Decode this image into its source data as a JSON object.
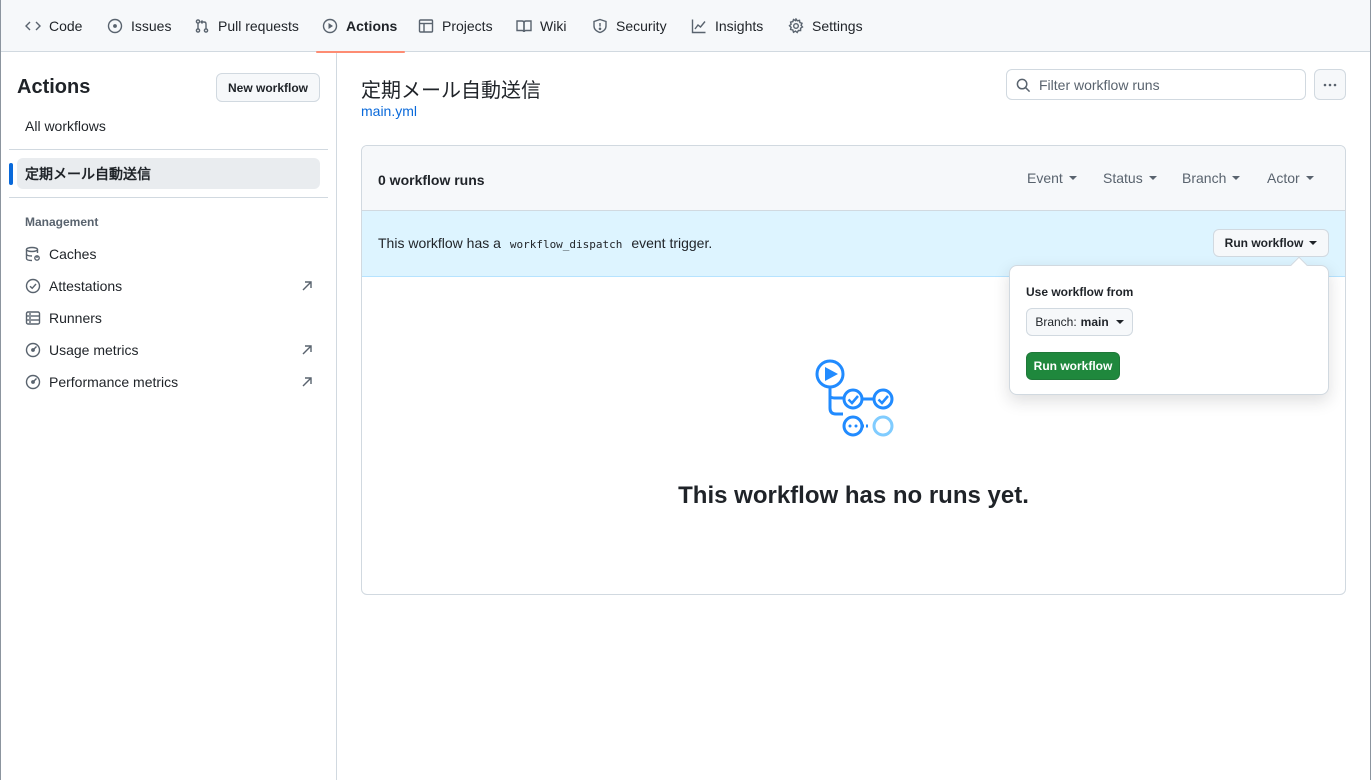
{
  "repo_nav": {
    "tabs": [
      {
        "label": "Code",
        "icon": "code-icon"
      },
      {
        "label": "Issues",
        "icon": "issue-opened-icon"
      },
      {
        "label": "Pull requests",
        "icon": "git-pull-request-icon"
      },
      {
        "label": "Actions",
        "icon": "play-icon",
        "selected": true
      },
      {
        "label": "Projects",
        "icon": "table-icon"
      },
      {
        "label": "Wiki",
        "icon": "book-icon"
      },
      {
        "label": "Security",
        "icon": "shield-icon"
      },
      {
        "label": "Insights",
        "icon": "graph-icon"
      },
      {
        "label": "Settings",
        "icon": "gear-icon"
      }
    ]
  },
  "sidebar": {
    "title": "Actions",
    "new_workflow_label": "New workflow",
    "all_workflows_label": "All workflows",
    "active_workflow": "定期メール自動送信",
    "management_heading": "Management",
    "items": [
      {
        "label": "Caches",
        "icon": "database-icon",
        "external": false
      },
      {
        "label": "Attestations",
        "icon": "verified-icon",
        "external": true
      },
      {
        "label": "Runners",
        "icon": "server-icon",
        "external": false
      },
      {
        "label": "Usage metrics",
        "icon": "meter-icon",
        "external": true
      },
      {
        "label": "Performance metrics",
        "icon": "meter-icon",
        "external": true
      }
    ]
  },
  "main": {
    "workflow_title": "定期メール自動送信",
    "workflow_file": "main.yml",
    "filter_placeholder": "Filter workflow runs",
    "runs_count": "0 workflow runs",
    "filters": {
      "event": "Event",
      "status": "Status",
      "branch": "Branch",
      "actor": "Actor"
    },
    "dispatch_prefix": "This workflow has a",
    "dispatch_code": "workflow_dispatch",
    "dispatch_suffix": "event trigger.",
    "run_workflow_label": "Run workflow",
    "blank_message": "This workflow has no runs yet."
  },
  "popover": {
    "use_from_label": "Use workflow from",
    "branch_prefix": "Branch:",
    "branch_value": "main",
    "run_button_label": "Run workflow"
  },
  "colors": {
    "accent_blue": "#0969da",
    "selected_underline": "#fd8c73",
    "run_green": "#1f883d",
    "dispatch_bg": "#ddf4ff"
  }
}
